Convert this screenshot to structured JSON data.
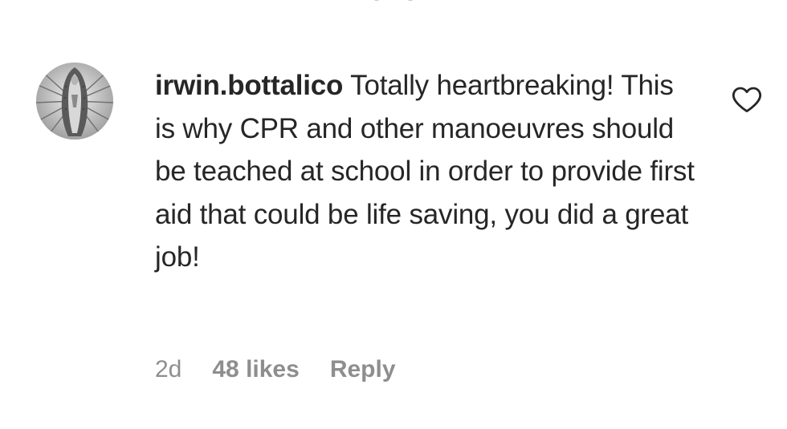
{
  "comment": {
    "username": "irwin.bottalico",
    "text": "Totally heartbreaking! This is why CPR and other manoeuvres should be teached at school in order to provide first aid that could be life saving, you did a great job!",
    "time": "2d",
    "likes": "48 likes",
    "reply_label": "Reply"
  },
  "icons": {
    "like": "heart-outline-icon",
    "avatar": "profile-avatar"
  },
  "colors": {
    "text": "#262626",
    "secondary": "#8e8e8e"
  }
}
